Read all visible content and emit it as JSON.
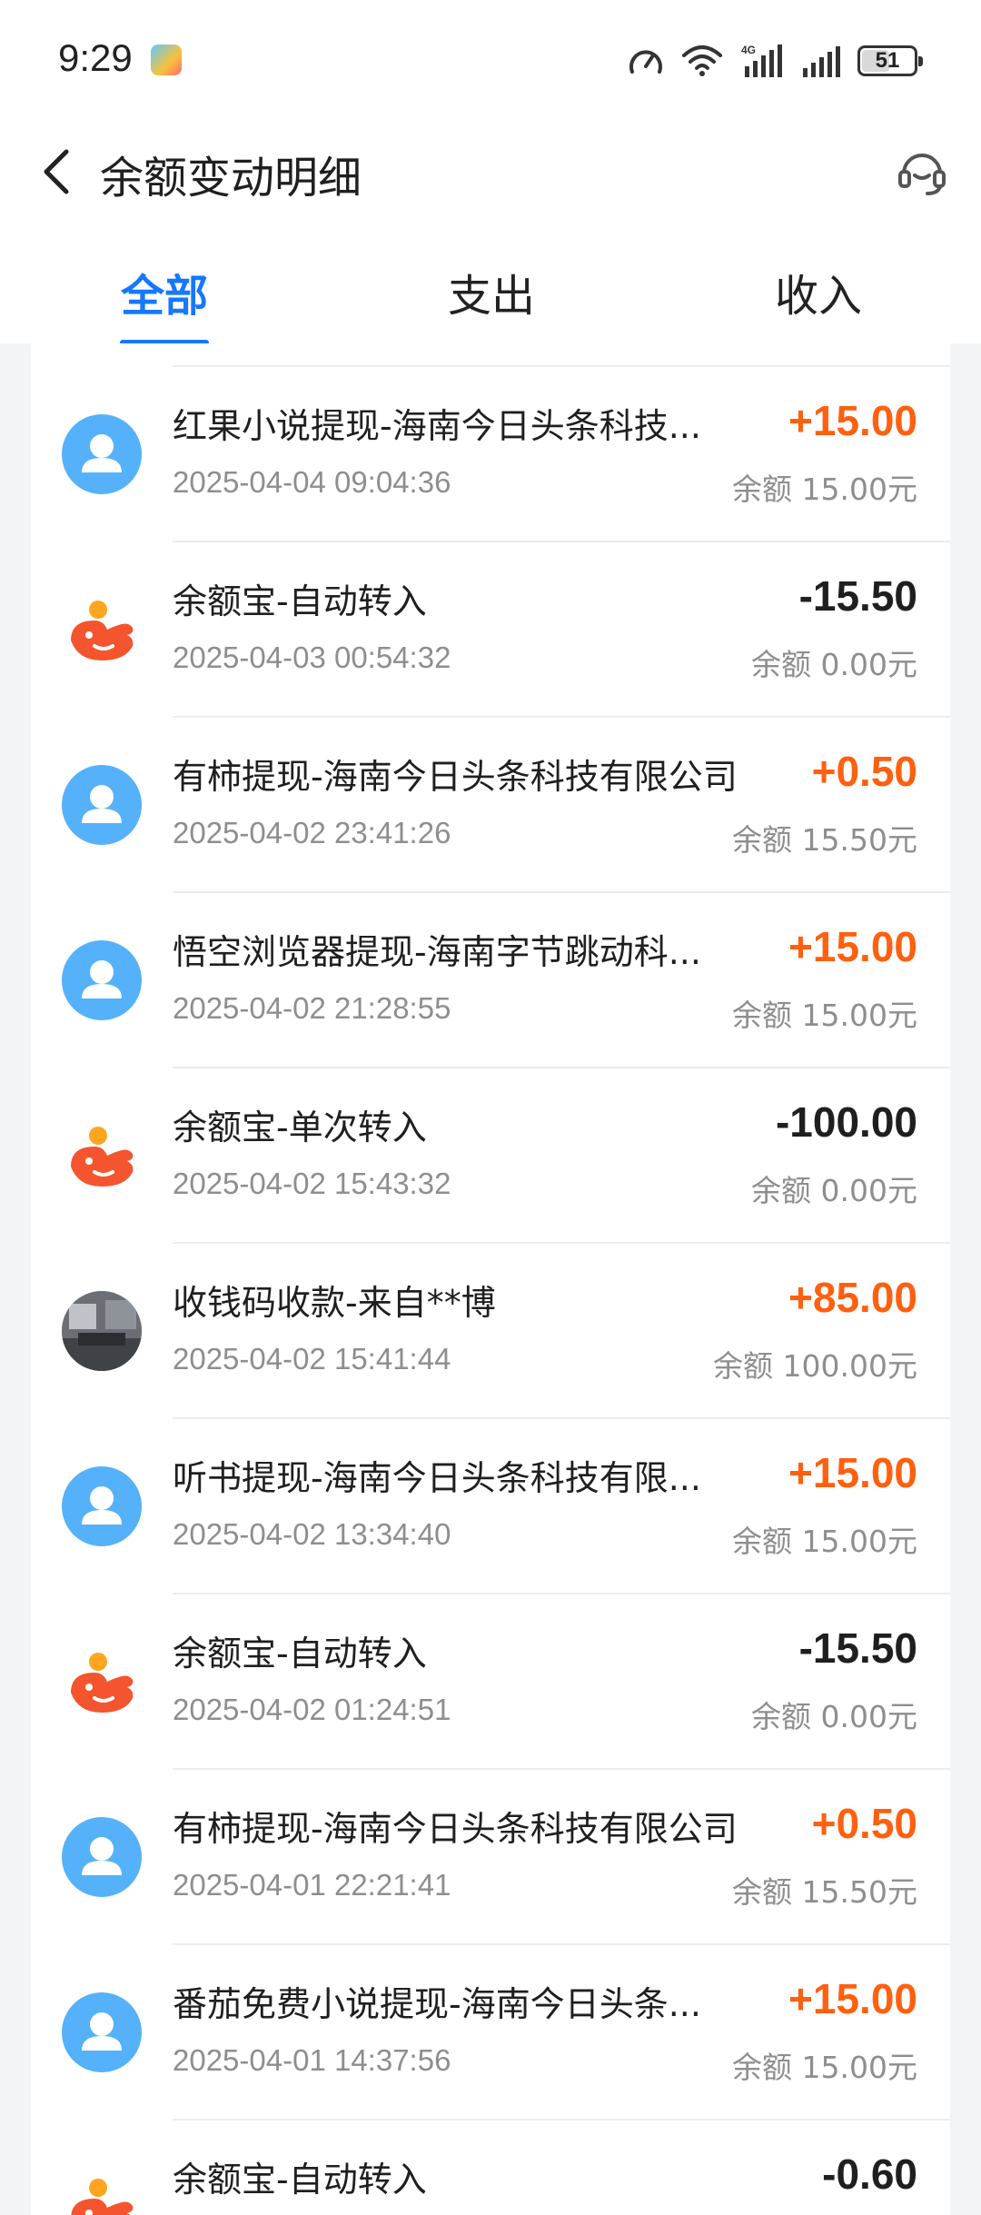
{
  "status_bar": {
    "time": "9:29",
    "battery": "51"
  },
  "header": {
    "title": "余额变动明细"
  },
  "tabs": [
    {
      "label": "全部",
      "active": true
    },
    {
      "label": "支出",
      "active": false
    },
    {
      "label": "收入",
      "active": false
    }
  ],
  "transactions": [
    {
      "title": "红果小说提现-海南今日头条科技...",
      "date": "2025-04-04 09:04:36",
      "amount": "+15.00",
      "balance": "余额 15.00元",
      "icon": "person-avatar-icon"
    },
    {
      "title": "余额宝-自动转入",
      "date": "2025-04-03 00:54:32",
      "amount": "-15.50",
      "balance": "余额 0.00元",
      "icon": "yuebao-icon"
    },
    {
      "title": "有柿提现-海南今日头条科技有限公司",
      "date": "2025-04-02 23:41:26",
      "amount": "+0.50",
      "balance": "余额 15.50元",
      "icon": "person-avatar-icon"
    },
    {
      "title": "悟空浏览器提现-海南字节跳动科...",
      "date": "2025-04-02 21:28:55",
      "amount": "+15.00",
      "balance": "余额 15.00元",
      "icon": "person-avatar-icon"
    },
    {
      "title": "余额宝-单次转入",
      "date": "2025-04-02 15:43:32",
      "amount": "-100.00",
      "balance": "余额 0.00元",
      "icon": "yuebao-icon"
    },
    {
      "title": "收钱码收款-来自**博",
      "date": "2025-04-02 15:41:44",
      "amount": "+85.00",
      "balance": "余额 100.00元",
      "icon": "photo-avatar"
    },
    {
      "title": "听书提现-海南今日头条科技有限...",
      "date": "2025-04-02 13:34:40",
      "amount": "+15.00",
      "balance": "余额 15.00元",
      "icon": "person-avatar-icon"
    },
    {
      "title": "余额宝-自动转入",
      "date": "2025-04-02 01:24:51",
      "amount": "-15.50",
      "balance": "余额 0.00元",
      "icon": "yuebao-icon"
    },
    {
      "title": "有柿提现-海南今日头条科技有限公司",
      "date": "2025-04-01 22:21:41",
      "amount": "+0.50",
      "balance": "余额 15.50元",
      "icon": "person-avatar-icon"
    },
    {
      "title": "番茄免费小说提现-海南今日头条...",
      "date": "2025-04-01 14:37:56",
      "amount": "+15.00",
      "balance": "余额 15.00元",
      "icon": "person-avatar-icon"
    },
    {
      "title": "余额宝-自动转入",
      "date": "",
      "amount": "-0.60",
      "balance": "",
      "icon": "yuebao-icon"
    }
  ],
  "colors": {
    "accent": "#1677ff",
    "income": "#ff6010",
    "expense": "#1f1f1f",
    "avatar_blue": "#55b1fa",
    "yuebao_red": "#f4552e"
  }
}
